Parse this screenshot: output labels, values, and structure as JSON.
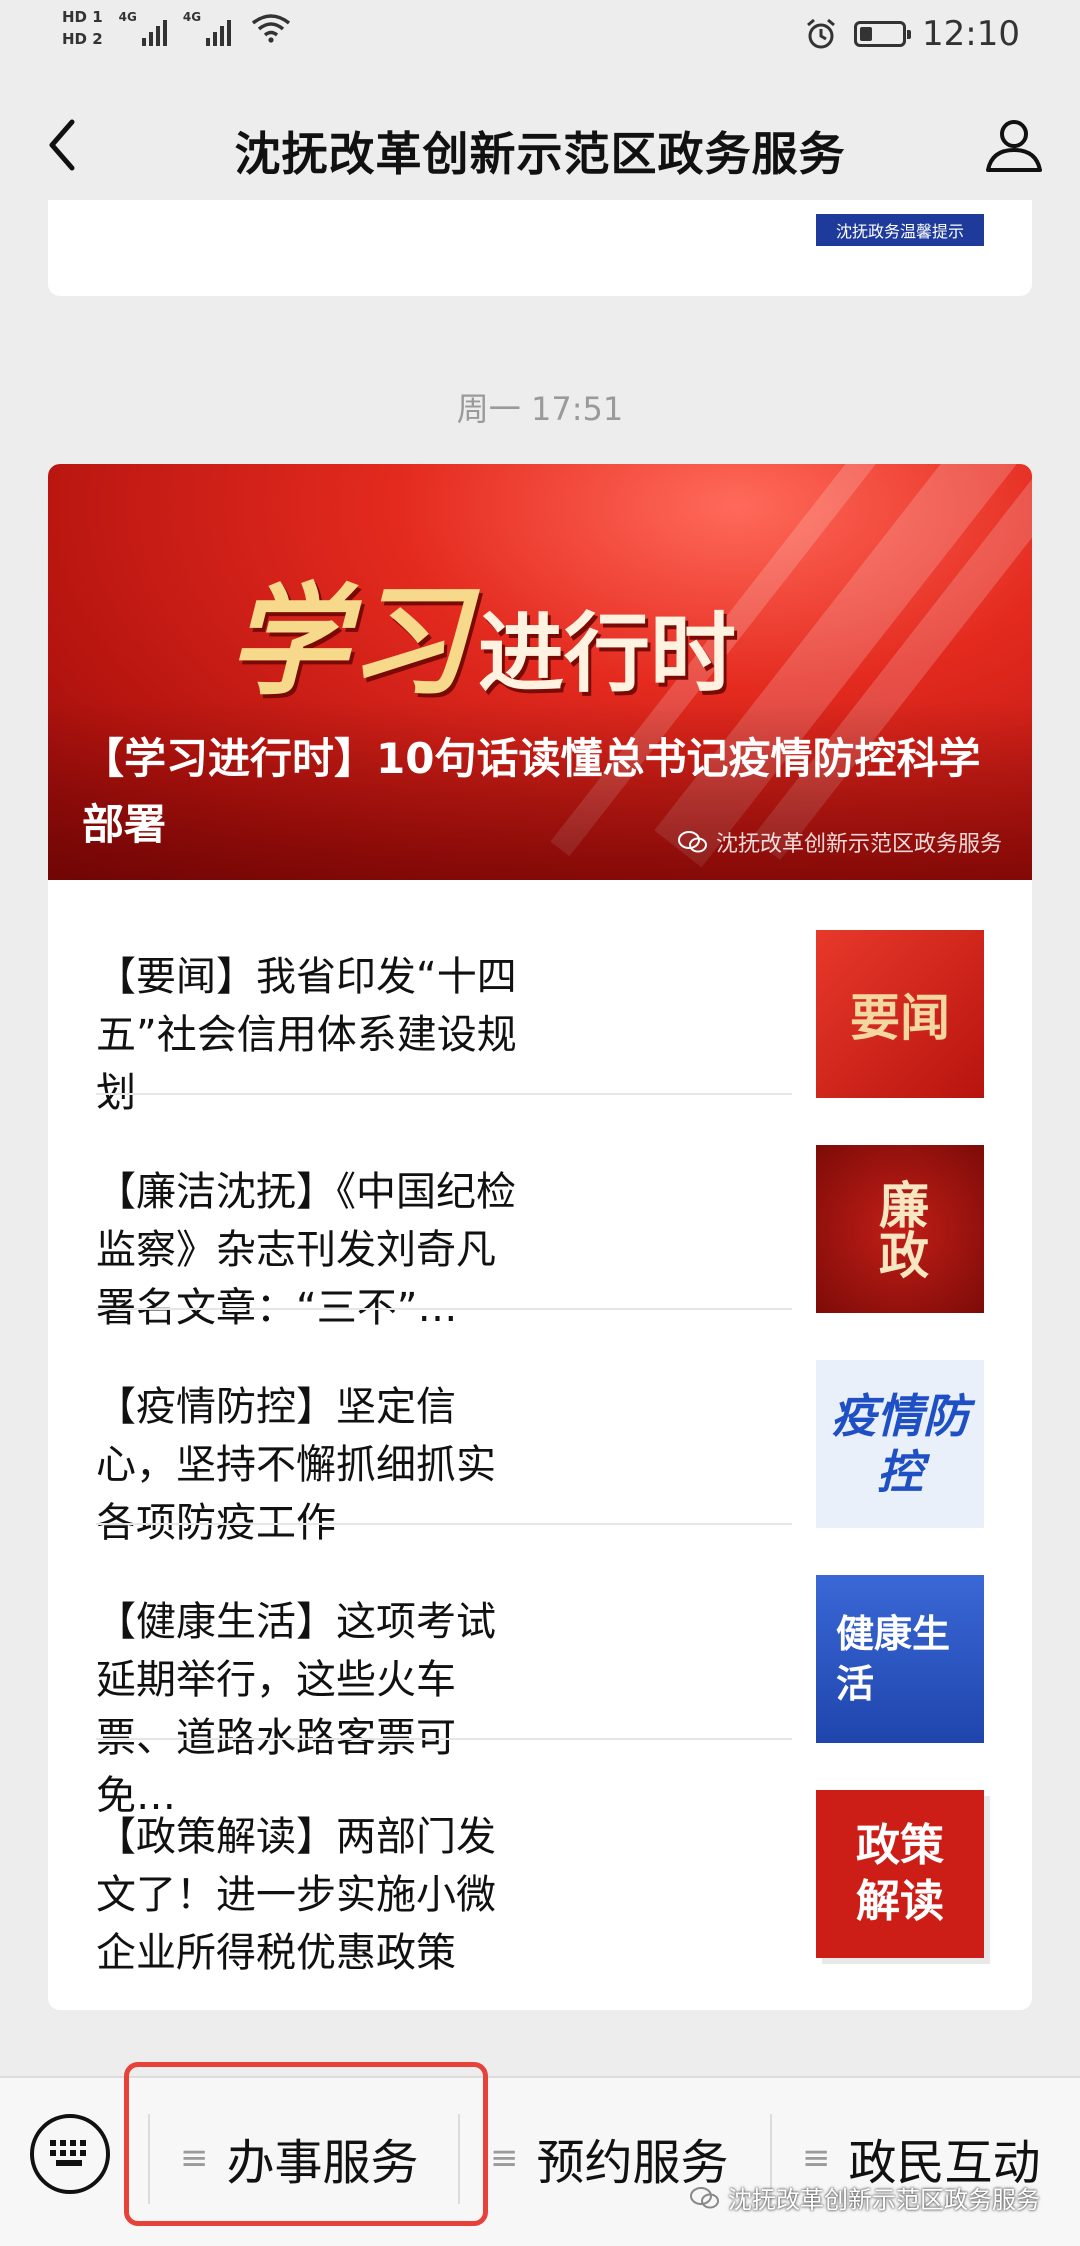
{
  "status_bar": {
    "sim1": "HD 1",
    "sim2": "HD 2",
    "net1": "4G",
    "net2": "4G",
    "time": "12:10"
  },
  "nav": {
    "title": "沈抚改革创新示范区政务服务"
  },
  "previous_card": {
    "thumb_text": "沈抚政务温馨提示"
  },
  "timestamp": "周一 17:51",
  "hero": {
    "banner_big": "学习",
    "banner_small": "进行时",
    "title": "【学习进行时】10句话读懂总书记疫情防控科学部署",
    "watermark": "沈抚改革创新示范区政务服务"
  },
  "articles": [
    {
      "text": "【要闻】我省印发“十四五”社会信用体系建设规划",
      "thumb": "要闻",
      "thumb_color": "#d9281c"
    },
    {
      "text": "【廉洁沈抚】《中国纪检监察》杂志刊发刘奇凡署名文章：“三不”…",
      "thumb": "廉政",
      "thumb_color": "#a3130f"
    },
    {
      "text": "【疫情防控】坚定信心，坚持不懈抓细抓实各项防疫工作",
      "thumb": "疫情防控",
      "thumb_color": "#e8eef8"
    },
    {
      "text": "【健康生活】这项考试延期举行，这些火车票、道路水路客票可免…",
      "thumb": "健康生活",
      "thumb_color": "#2b58c9"
    },
    {
      "text": "【政策解读】两部门发文了！进一步实施小微企业所得税优惠政策",
      "thumb": "政策解读",
      "thumb_color": "#cc1d17"
    }
  ],
  "bottom_menu": {
    "items": [
      "办事服务",
      "预约服务",
      "政民互动"
    ],
    "watermark": "沈抚改革创新示范区政务服务"
  },
  "colors": {
    "highlight": "#e8413a",
    "hero_red": "#e42a1f"
  }
}
